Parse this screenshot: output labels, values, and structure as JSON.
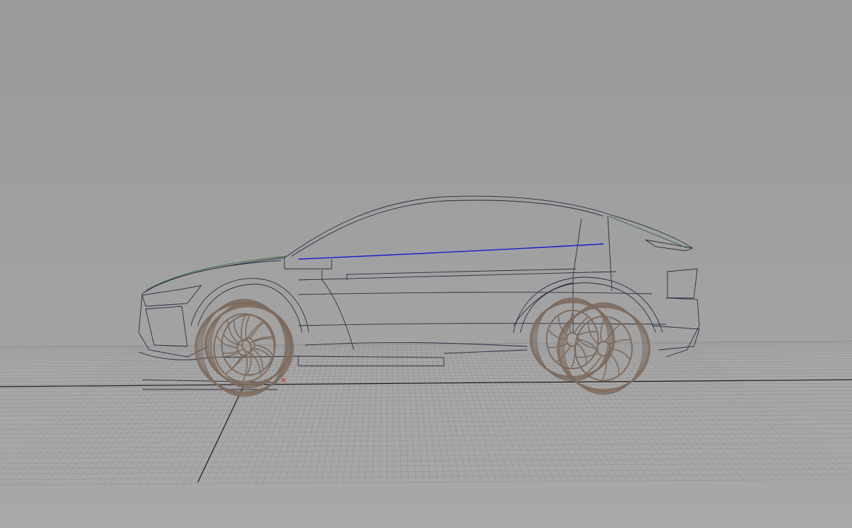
{
  "viewport": {
    "background_color": "#a0a0a0",
    "grid_color": "#8c8c8c",
    "axis_color": "#1a1a1a"
  },
  "model": {
    "wire_color": "#2a2a40",
    "highlight_curve_color": "#1a1ad0",
    "green_curve_color": "#2f6a3a",
    "wheel_color": "#7d6a5c"
  },
  "gizmo": {
    "pivot_icon": "x-marker-icon",
    "pivot_color": "#d01010"
  }
}
